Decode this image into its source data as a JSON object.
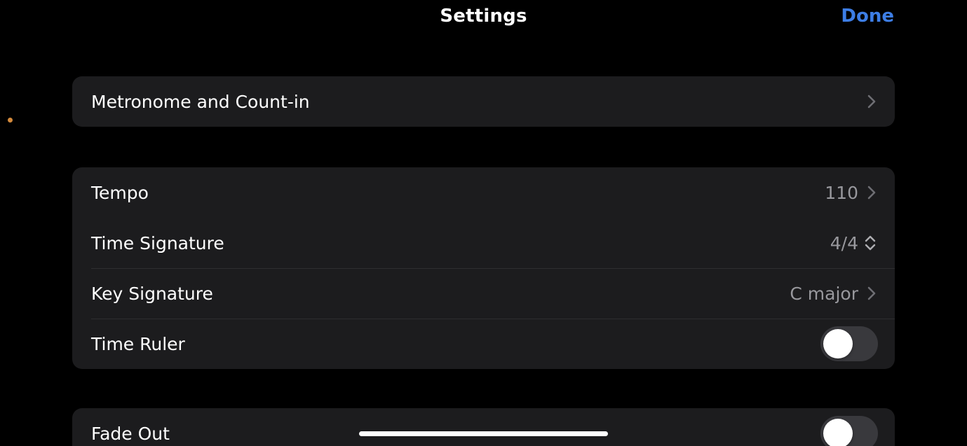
{
  "nav": {
    "title": "Settings",
    "done_label": "Done"
  },
  "groups": [
    {
      "rows": [
        {
          "label": "Metronome and Count-in",
          "value": "",
          "accessory": "chevron-right-icon"
        }
      ]
    },
    {
      "rows": [
        {
          "label": "Tempo",
          "value": "110",
          "accessory": "chevron-right-icon"
        },
        {
          "label": "Time Signature",
          "value": "4/4",
          "accessory": "chevron-up-down-icon"
        },
        {
          "label": "Key Signature",
          "value": "C major",
          "accessory": "chevron-right-icon"
        },
        {
          "label": "Time Ruler",
          "toggle_on": false
        }
      ]
    },
    {
      "rows": [
        {
          "label": "Fade Out",
          "toggle_on": false
        }
      ]
    }
  ],
  "colors": {
    "background": "#000000",
    "group_background": "#1c1c1e",
    "accent": "#3d7ee6",
    "secondary_text": "#98989d",
    "toggle_off": "#39393d"
  }
}
